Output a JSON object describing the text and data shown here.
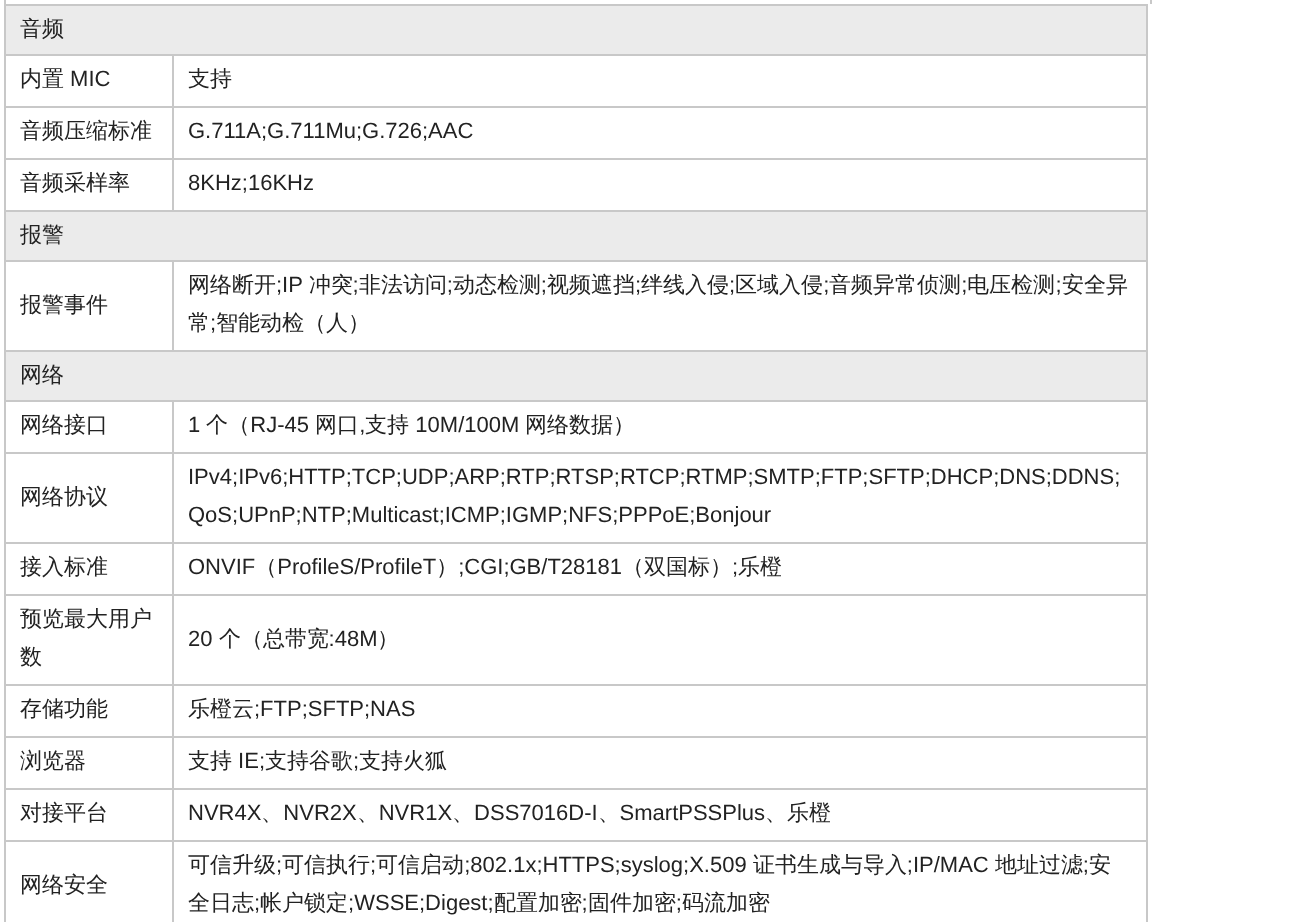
{
  "sections": [
    {
      "title": "音频",
      "rows": [
        {
          "label": "内置 MIC",
          "value": "支持"
        },
        {
          "label": "音频压缩标准",
          "value": "G.711A;G.711Mu;G.726;AAC"
        },
        {
          "label": "音频采样率",
          "value": "8KHz;16KHz"
        }
      ]
    },
    {
      "title": "报警",
      "rows": [
        {
          "label": "报警事件",
          "value": "网络断开;IP 冲突;非法访问;动态检测;视频遮挡;绊线入侵;区域入侵;音频异常侦测;电压检测;安全异常;智能动检（人）"
        }
      ]
    },
    {
      "title": "网络",
      "rows": [
        {
          "label": "网络接口",
          "value": "1 个（RJ-45 网口,支持 10M/100M 网络数据）"
        },
        {
          "label": "网络协议",
          "value": "IPv4;IPv6;HTTP;TCP;UDP;ARP;RTP;RTSP;RTCP;RTMP;SMTP;FTP;SFTP;DHCP;DNS;DDNS;QoS;UPnP;NTP;Multicast;ICMP;IGMP;NFS;PPPoE;Bonjour"
        },
        {
          "label": "接入标准",
          "value": "ONVIF（ProfileS/ProfileT）;CGI;GB/T28181（双国标）;乐橙"
        },
        {
          "label": "预览最大用户数",
          "value": "20 个（总带宽:48M）"
        },
        {
          "label": "存储功能",
          "value": "乐橙云;FTP;SFTP;NAS"
        },
        {
          "label": "浏览器",
          "value": "支持 IE;支持谷歌;支持火狐"
        },
        {
          "label": "对接平台",
          "value": "NVR4X、NVR2X、NVR1X、DSS7016D-I、SmartPSSPlus、乐橙"
        },
        {
          "label": "网络安全",
          "value": "可信升级;可信执行;可信启动;802.1x;HTTPS;syslog;X.509 证书生成与导入;IP/MAC 地址过滤;安全日志;帐户锁定;WSSE;Digest;配置加密;固件加密;码流加密"
        }
      ]
    }
  ]
}
